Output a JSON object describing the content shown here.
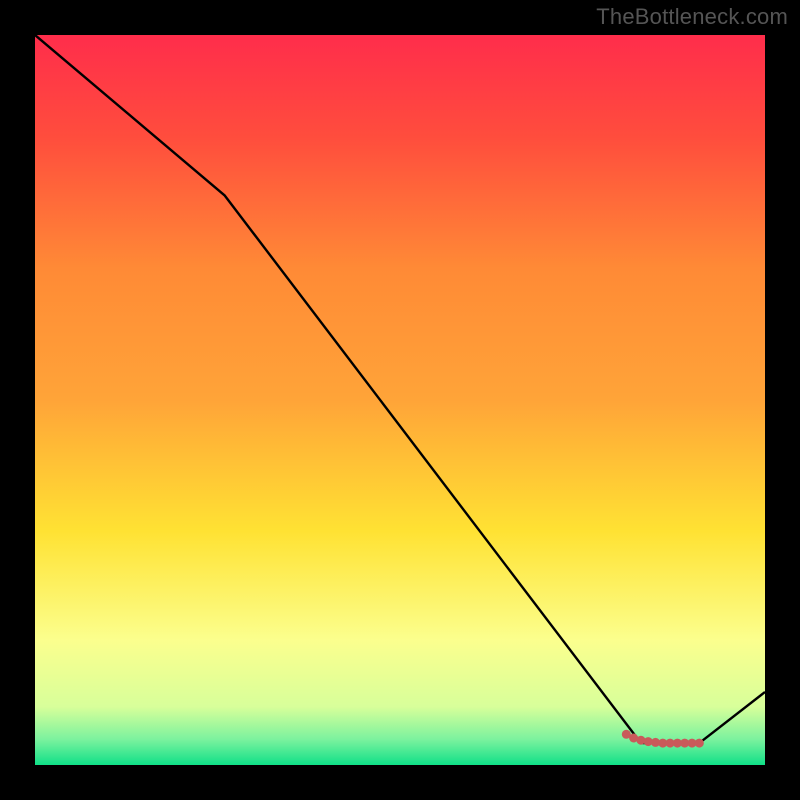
{
  "watermark": "TheBottleneck.com",
  "colors": {
    "background": "#000000",
    "gradient_top": "#ff2d4b",
    "gradient_mid1": "#ffa438",
    "gradient_mid2": "#ffe233",
    "gradient_low": "#fbff8e",
    "gradient_bottom": "#10e088",
    "line": "#000000",
    "marker": "#c95a5a"
  },
  "chart_data": {
    "type": "line",
    "title": "",
    "xlabel": "",
    "ylabel": "",
    "xlim": [
      0,
      100
    ],
    "ylim": [
      0,
      100
    ],
    "series": [
      {
        "name": "main-line",
        "x": [
          0,
          26,
          83,
          91,
          100
        ],
        "values": [
          100,
          78,
          3,
          3,
          10
        ]
      },
      {
        "name": "marker-band",
        "x": [
          81,
          82,
          83,
          84,
          85,
          86,
          87,
          88,
          89,
          90,
          91
        ],
        "values": [
          4.2,
          3.7,
          3.4,
          3.2,
          3.1,
          3.0,
          3.0,
          3.0,
          3.0,
          3.0,
          3.0
        ]
      }
    ]
  }
}
